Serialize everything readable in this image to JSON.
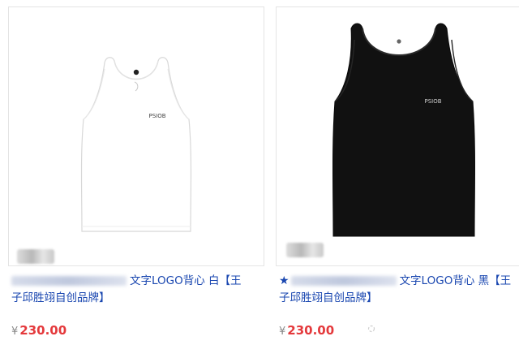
{
  "products": [
    {
      "title_line1": "文字LOGO背心 白【王",
      "title_line2": "子邱胜翊自创品牌】",
      "currency": "¥",
      "price": "230.00",
      "shirt_color": "#ffffff",
      "shirt_image_label": "white tank top"
    },
    {
      "star": "★",
      "title_line1": "文字LOGO背心 黑【王",
      "title_line2": "子邱胜翊自创品牌】",
      "currency": "¥",
      "price": "230.00",
      "shirt_color": "#111111",
      "shirt_image_label": "black tank top"
    }
  ],
  "colors": {
    "link": "#1a47b0",
    "price": "#e4393c"
  }
}
